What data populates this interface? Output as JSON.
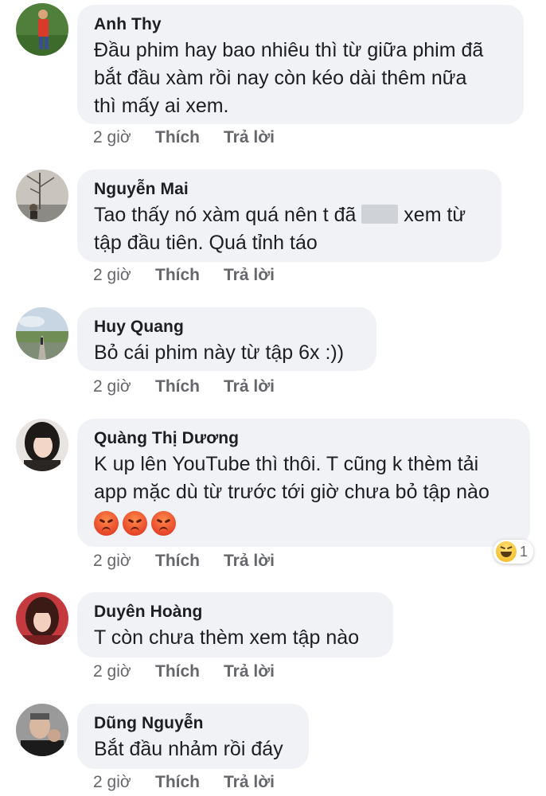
{
  "comments": [
    {
      "name": "Anh Thy",
      "text": "Đầu phim hay bao nhiêu thì từ giữa phim đã\nbắt đầu xàm rồi nay còn kéo dài thêm nữa\nthì mấy ai xem.",
      "time": "2 giờ",
      "like": "Thích",
      "reply": "Trả lời"
    },
    {
      "name": "Nguyễn Mai",
      "text_before": "Tao thấy nó xàm quá nên t đã ",
      "text_after": " xem từ\ntập đầu tiên. Quá tỉnh táo",
      "time": "2 giờ",
      "like": "Thích",
      "reply": "Trả lời"
    },
    {
      "name": "Huy Quang",
      "text": "Bỏ cái phim này từ tập 6x :))",
      "time": "2 giờ",
      "like": "Thích",
      "reply": "Trả lời"
    },
    {
      "name": "Quàng Thị Dương",
      "text": "K up lên YouTube  thì thôi. T cũng k thèm tải\napp mặc dù từ trước tới giờ chưa bỏ tập nào",
      "emojis": [
        "angry-face",
        "angry-face",
        "angry-face"
      ],
      "time": "2 giờ",
      "like": "Thích",
      "reply": "Trả lời",
      "reaction": {
        "icon": "haha-icon",
        "count": "1"
      }
    },
    {
      "name": "Duyên Hoàng",
      "text": "T còn chưa thèm xem tập nào",
      "time": "2 giờ",
      "like": "Thích",
      "reply": "Trả lời"
    },
    {
      "name": "Dũng Nguyễn",
      "text": "Bắt đầu nhảm rồi đáy",
      "time": "2 giờ",
      "like": "Thích",
      "reply": "Trả lời"
    }
  ]
}
